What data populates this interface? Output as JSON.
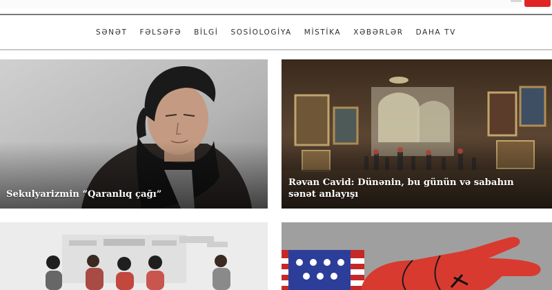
{
  "nav": {
    "items": [
      {
        "label": "SƏNƏT"
      },
      {
        "label": "FƏLSƏFƏ"
      },
      {
        "label": "BİLGİ"
      },
      {
        "label": "SOSİOLOGİYA"
      },
      {
        "label": "MİSTİKA"
      },
      {
        "label": "XƏBƏRLƏR"
      },
      {
        "label": "DAHA TV"
      }
    ]
  },
  "articles": [
    {
      "title": "Sekulyarizmin “Qaranlıq çağı”"
    },
    {
      "title": "Rəvan Cavid: Dünənin, bu günün və sabahın sənət anlayışı"
    }
  ],
  "colors": {
    "accent": "#e02424",
    "nav_text": "#2d2d2d"
  }
}
